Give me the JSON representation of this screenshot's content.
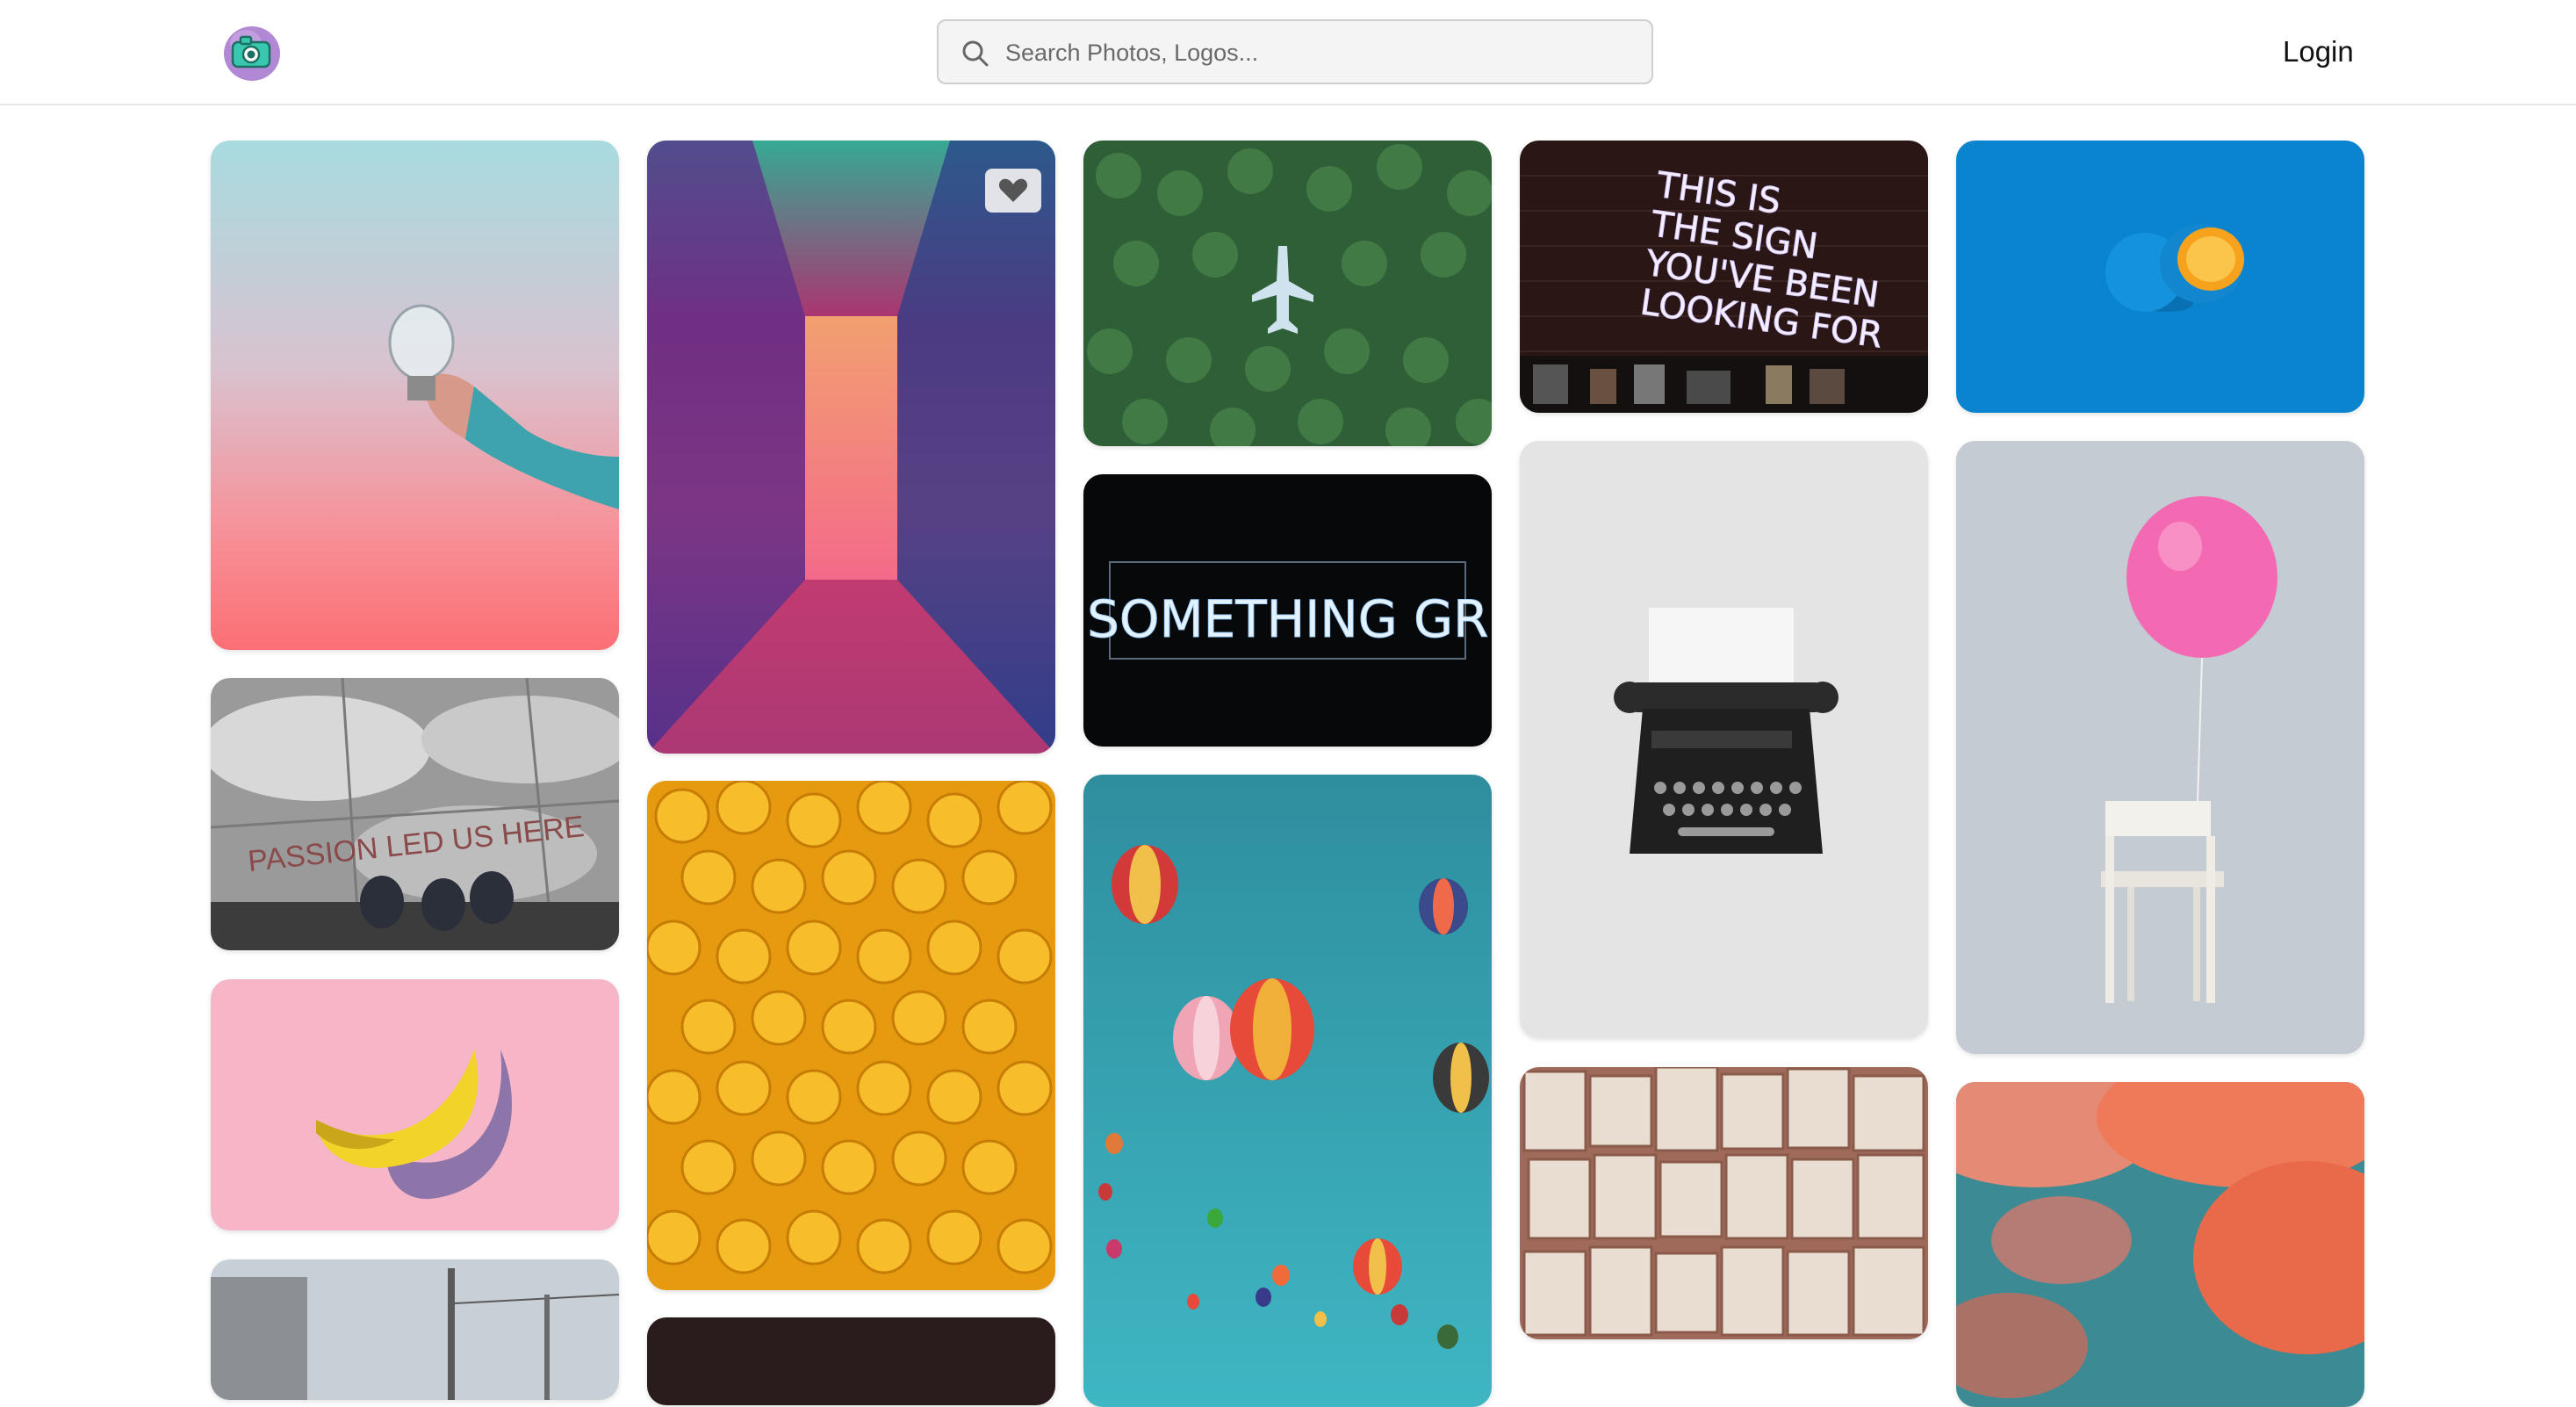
{
  "header": {
    "logo_icon": "camera-icon",
    "search": {
      "placeholder": "Search Photos, Logos...",
      "value": "",
      "icon": "search-icon"
    },
    "login_label": "Login"
  },
  "gallery": {
    "favorite_icon": "heart-icon",
    "photos": [
      {
        "id": "lightbulb-hand",
        "subject": "hand holding a light bulb against a pink sky"
      },
      {
        "id": "neon-corridor",
        "subject": "neon lit corridor",
        "favorite_visible": true
      },
      {
        "id": "plane-forest",
        "subject": "airplane over a pine forest"
      },
      {
        "id": "neon-sign-looking",
        "subject": "neon sign on a brick wall",
        "text_lines": [
          "THIS IS",
          "THE SIGN",
          "YOU'VE BEEN",
          "LOOKING FOR"
        ]
      },
      {
        "id": "blue-orange",
        "subject": "orange painted blue on a blue background"
      },
      {
        "id": "passion-floor",
        "subject": "floor with lettering",
        "text": "PASSION LED US HERE"
      },
      {
        "id": "neon-great",
        "subject": "neon sign",
        "text": "DO SOMETHING GREAT"
      },
      {
        "id": "typewriter",
        "subject": "typewriter on a grey background"
      },
      {
        "id": "balloon-chair",
        "subject": "pink balloon tied to a white chair"
      },
      {
        "id": "banana-pink",
        "subject": "banana on a pink background"
      },
      {
        "id": "lego-heads",
        "subject": "pile of yellow toy heads"
      },
      {
        "id": "hot-air-balloons",
        "subject": "hot air balloons in a teal sky"
      },
      {
        "id": "book-pages",
        "subject": "wall of open book pages"
      },
      {
        "id": "pink-clouds",
        "subject": "pink clouds"
      },
      {
        "id": "street-scene",
        "subject": "street with power lines"
      },
      {
        "id": "dark-partial",
        "subject": "dark photo, partially visible"
      }
    ]
  },
  "colors": {
    "accent": "#b57ad6",
    "logo_camera": "#3cc9b4",
    "header_border": "#e6e6e6",
    "search_bg": "#f4f4f4"
  }
}
